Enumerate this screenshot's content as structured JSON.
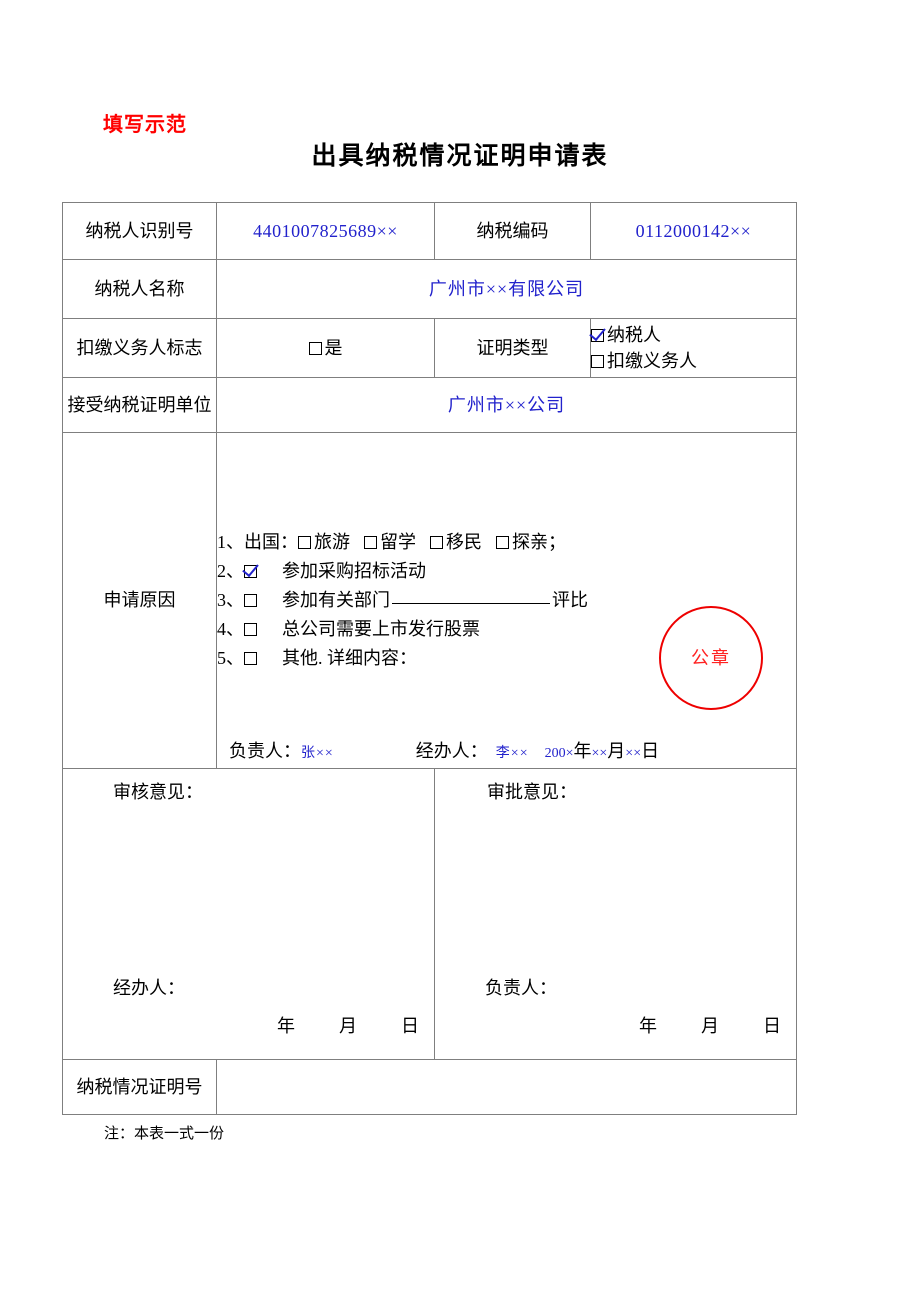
{
  "header": {
    "sample_label": "填写示范",
    "title": "出具纳税情况证明申请表"
  },
  "form": {
    "taxpayer_id_label": "纳税人识别号",
    "taxpayer_id_value": "4401007825689××",
    "tax_code_label": "纳税编码",
    "tax_code_value": "0112000142××",
    "taxpayer_name_label": "纳税人名称",
    "taxpayer_name_value": "广州市××有限公司",
    "withholding_flag_label": "扣缴义务人标志",
    "withholding_flag_option": "是",
    "cert_type_label": "证明类型",
    "cert_type_option_1": "纳税人",
    "cert_type_option_2": "扣缴义务人",
    "receiving_unit_label": "接受纳税证明单位",
    "receiving_unit_value": "广州市××公司",
    "reason_label": "申请原因",
    "reasons": [
      {
        "no": "1、",
        "text": "出国：",
        "options": [
          "旅游",
          "留学",
          "移民",
          "探亲；"
        ],
        "checked": false
      },
      {
        "no": "2、",
        "text": "参加采购招标活动",
        "checked": true
      },
      {
        "no": "3、",
        "text_before": "参加有关部门",
        "text_after": "评比",
        "checked": false
      },
      {
        "no": "4、",
        "text": "总公司需要上市发行股票",
        "checked": false
      },
      {
        "no": "5、",
        "text": "其他. 详细内容：",
        "checked": false
      }
    ],
    "seal_text": "公章",
    "responsible_label": "负责人：",
    "responsible_value": "张××",
    "handler_label": "经办人：",
    "handler_value": "李××",
    "date_value": "200×",
    "date_year": "年",
    "date_month_x": "××",
    "date_month": "月",
    "date_day_x": "××",
    "date_day": "日",
    "review_opinion_label": "审核意见：",
    "review_handler_label": "经办人：",
    "approval_opinion_label": "审批意见：",
    "approval_responsible_label": "负责人：",
    "blank_year": "年",
    "blank_month": "月",
    "blank_day": "日",
    "cert_number_label": "纳税情况证明号",
    "cert_number_value": ""
  },
  "footer": {
    "note": "注：本表一式一份"
  }
}
